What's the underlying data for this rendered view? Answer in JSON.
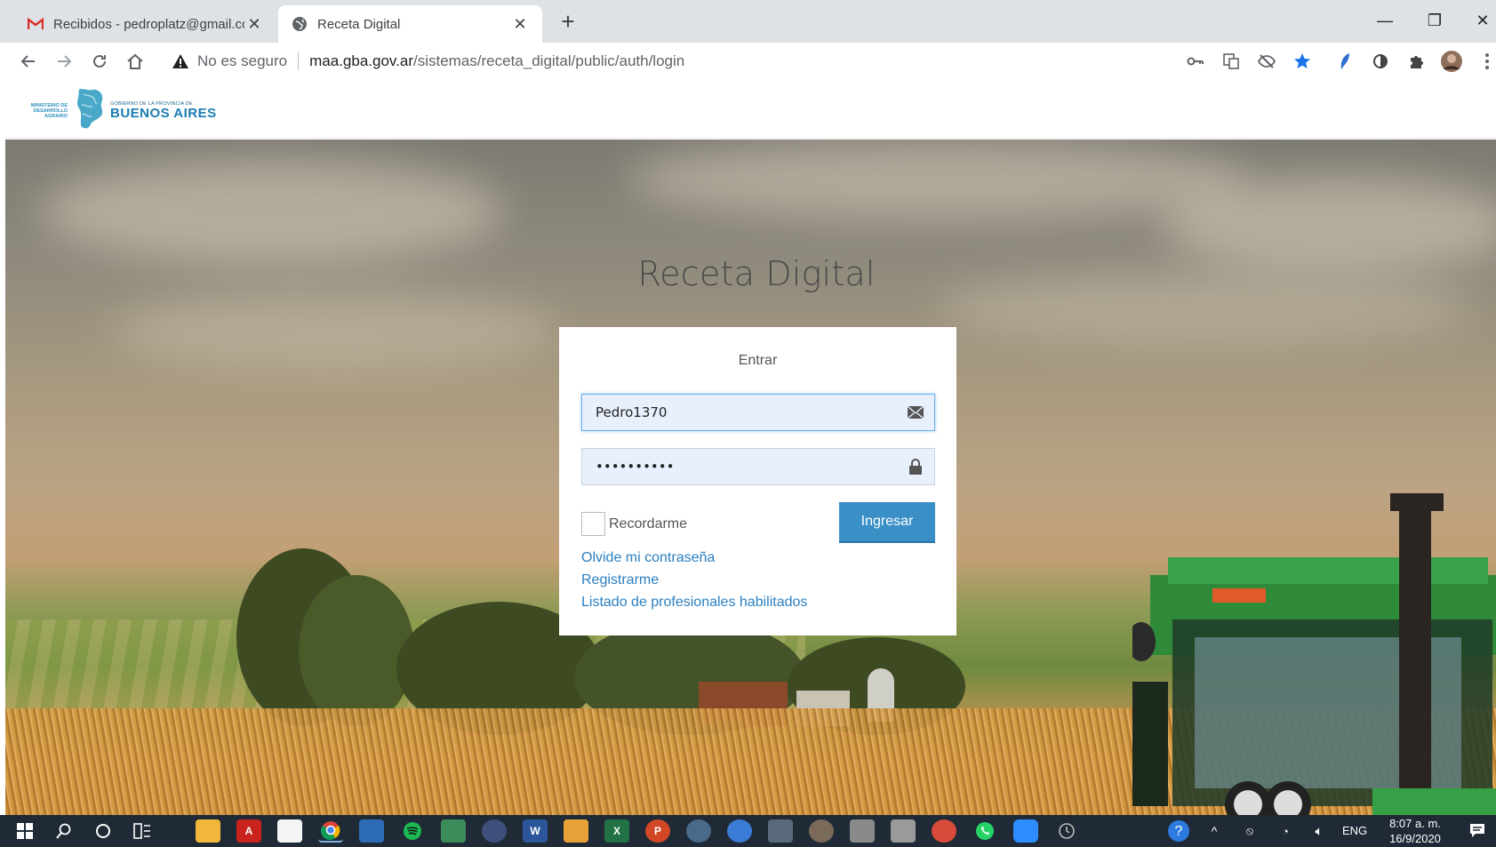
{
  "browser": {
    "tabs": [
      {
        "title": "Recibidos - pedroplatz@gmail.co",
        "icon": "gmail-icon",
        "active": false
      },
      {
        "title": "Receta Digital",
        "icon": "globe-icon",
        "active": true
      }
    ],
    "new_tab": "+",
    "window_controls": {
      "minimize": "—",
      "restore": "❐",
      "close": "✕"
    },
    "security_label": "No es seguro",
    "url_host": "maa.gba.gov.ar",
    "url_path": "/sistemas/receta_digital/public/auth/login",
    "accent_color": "#1a73e8"
  },
  "header": {
    "ministry_line1": "MINISTERIO DE",
    "ministry_line2": "DESARROLLO AGRARIO",
    "gov_sub": "GOBIERNO DE LA PROVINCIA DE",
    "gov_main": "BUENOS AIRES",
    "brand_color": "#1a7cb3"
  },
  "page": {
    "title": "Receta Digital"
  },
  "login": {
    "heading": "Entrar",
    "username_value": "Pedro1370",
    "password_value": "••••••••••",
    "remember_label": "Recordarme",
    "submit_label": "Ingresar",
    "submit_color": "#3a8fc7",
    "links": {
      "forgot": "Olvide mi contraseña",
      "register": "Registrarme",
      "professionals": "Listado de profesionales habilitados"
    }
  },
  "taskbar": {
    "language": "ENG",
    "time": "8:07 a. m.",
    "date": "16/9/2020"
  }
}
